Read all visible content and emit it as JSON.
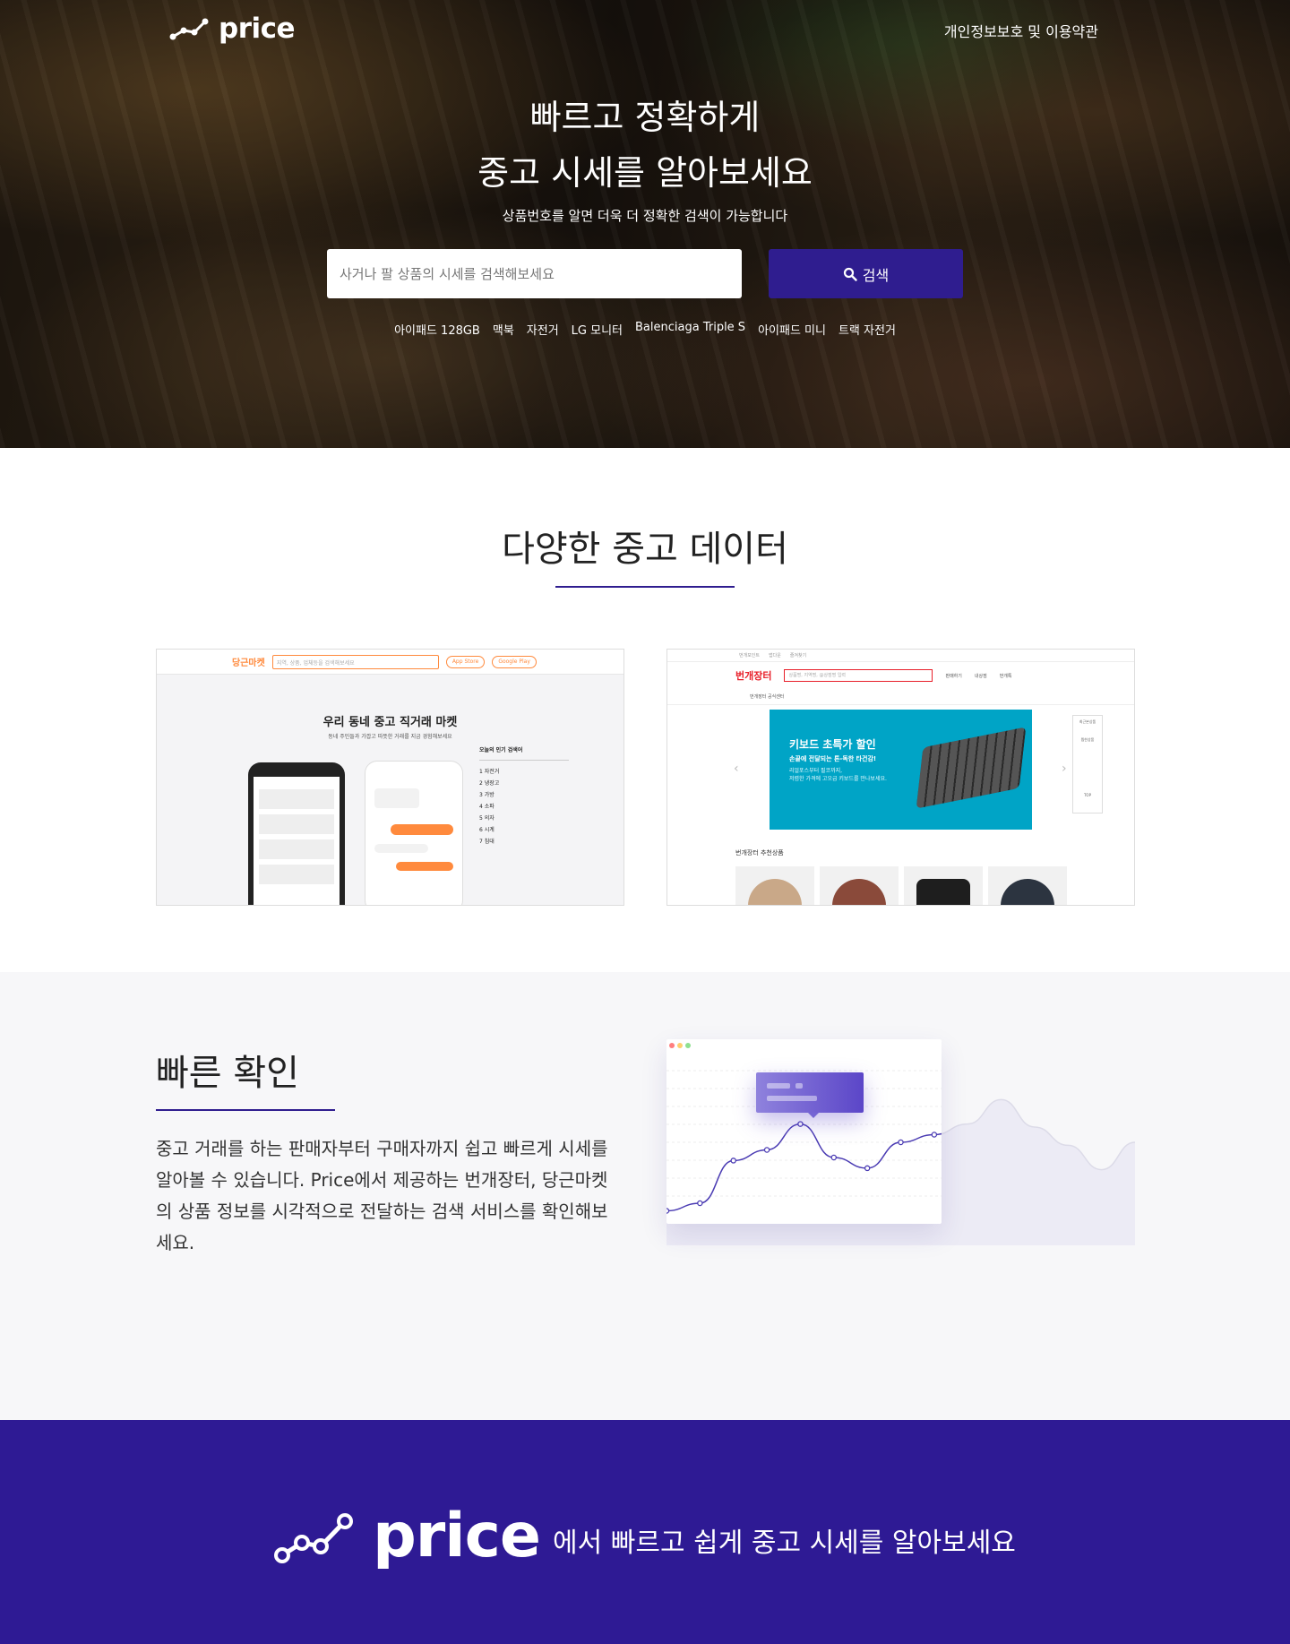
{
  "header": {
    "logo_text": "price",
    "policy_link": "개인정보보호 및 이용약관"
  },
  "hero": {
    "title_line1": "빠르고 정확하게",
    "title_line2": "중고 시세를 알아보세요",
    "subtitle": "상품번호를 알면 더욱 더 정확한 검색이 가능합니다",
    "search_placeholder": "사거나 팔 상품의 시세를 검색해보세요",
    "search_button": "검색",
    "keywords": [
      "아이패드 128GB",
      "맥북",
      "자전거",
      "LG 모니터",
      "Balenciaga Triple S",
      "아이패드 미니",
      "트랙 자전거"
    ]
  },
  "data_section": {
    "title": "다양한 중고 데이터",
    "daangn": {
      "logo": "당근마켓",
      "search_placeholder": "지역, 상품, 업체등을 검색해보세요",
      "app_store": "App Store",
      "google_play": "Google Play",
      "headline": "우리 동네 중고 직거래 마켓",
      "subline": "동네 주민들과 가깝고 따뜻한 거래를 지금 경험해보세요",
      "popular_title": "오늘의 인기 검색어",
      "popular": [
        "1 자전거",
        "2 냉장고",
        "3 가방",
        "4 소파",
        "5 의자",
        "6 시계",
        "7 침대"
      ]
    },
    "bunjang": {
      "logo": "번개장터",
      "top_links": [
        "번개포인트",
        "앱다운",
        "즐겨찾기"
      ],
      "search_placeholder": "상품명, 지역명, @상점명 입력",
      "menu": [
        "판매하기",
        "내상점",
        "번개톡"
      ],
      "category": "번개장터 공식센터",
      "banner_line1": "키보드 초특가 할인",
      "banner_line2": "손끝에 전달되는 톤-독한 타건감!",
      "banner_line3": "리얼포스부터 필코까지,",
      "banner_line4": "저렴한 가격에 고오급 키보드를 만나보세요.",
      "side_items": [
        "최근본상품",
        "찜한상품",
        "TOP"
      ],
      "recommend_title": "번개장터 추천상품"
    }
  },
  "fast_section": {
    "title": "빠른 확인",
    "description": "중고 거래를 하는 판매자부터 구매자까지 쉽고 빠르게 시세를 알아볼 수 있습니다. Price에서 제공하는 번개장터, 당근마켓의 상품 정보를 시각적으로 전달하는 검색 서비스를 확인해보세요.",
    "chart_points": [
      0.05,
      0.1,
      0.38,
      0.45,
      0.62,
      0.4,
      0.33,
      0.5,
      0.55,
      0.62,
      0.78,
      0.6,
      0.48,
      0.32,
      0.5
    ]
  },
  "footer": {
    "logo_text": "price",
    "tagline": "에서 빠르고 쉽게 중고 시세를 알아보세요"
  },
  "colors": {
    "brand": "#2f1d8f",
    "daangn": "#ff8a3d",
    "bunjang": "#e8202a"
  }
}
